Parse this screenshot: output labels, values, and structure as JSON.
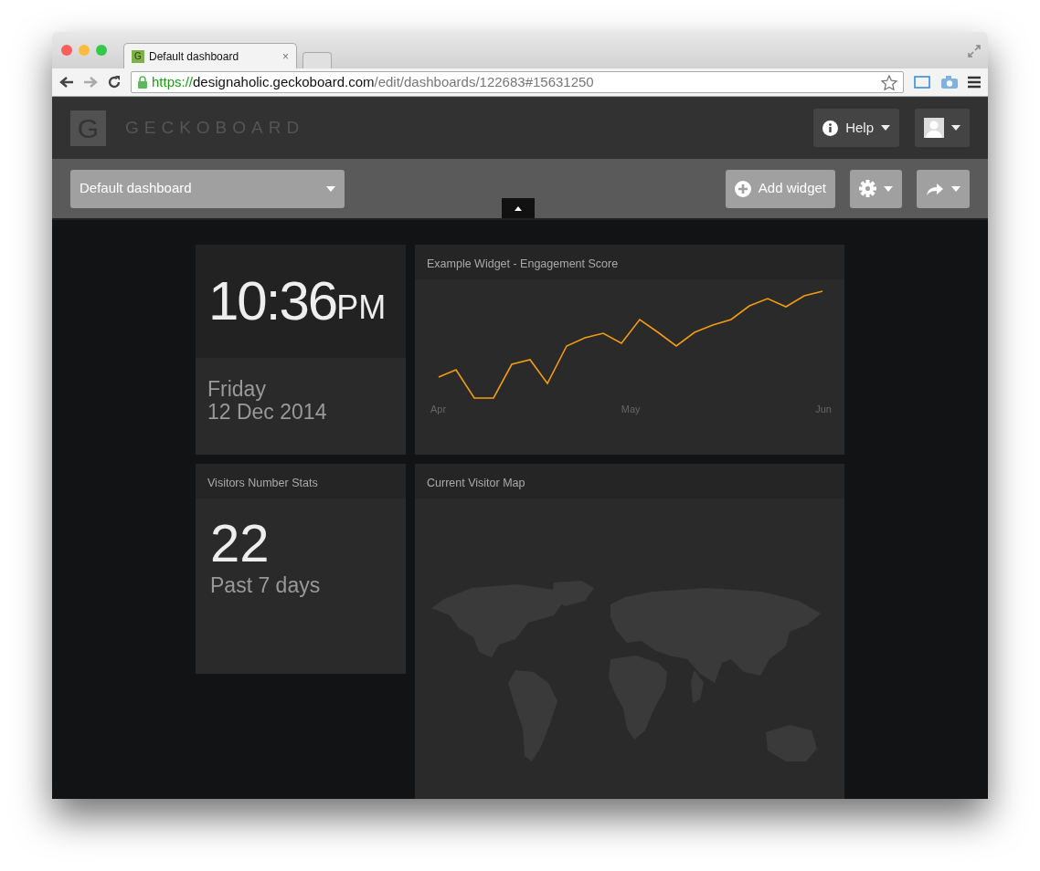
{
  "browser": {
    "tabs": [
      {
        "favicon_letter": "G",
        "title": "Default dashboard",
        "close": "×",
        "selected": true
      }
    ],
    "url": {
      "scheme": "https://",
      "host": "designaholic.geckoboard.com",
      "path": "/edit/dashboards/122683#15631250"
    }
  },
  "header": {
    "logo_letter": "G",
    "brand": "GECKOBOARD",
    "help": "Help"
  },
  "toolbar": {
    "dashboard": "Default dashboard",
    "add_widget": "Add widget"
  },
  "clock": {
    "time": "10:36",
    "meridiem": "PM",
    "day": "Friday",
    "date": "12 Dec 2014"
  },
  "chart_widget": {
    "title": "Example Widget - Engagement Score",
    "x_labels": [
      "Apr",
      "May",
      "Jun"
    ]
  },
  "number_widget": {
    "title": "Visitors Number Stats",
    "value": "22",
    "caption": "Past 7 days"
  },
  "map_widget": {
    "title": "Current Visitor Map"
  }
}
